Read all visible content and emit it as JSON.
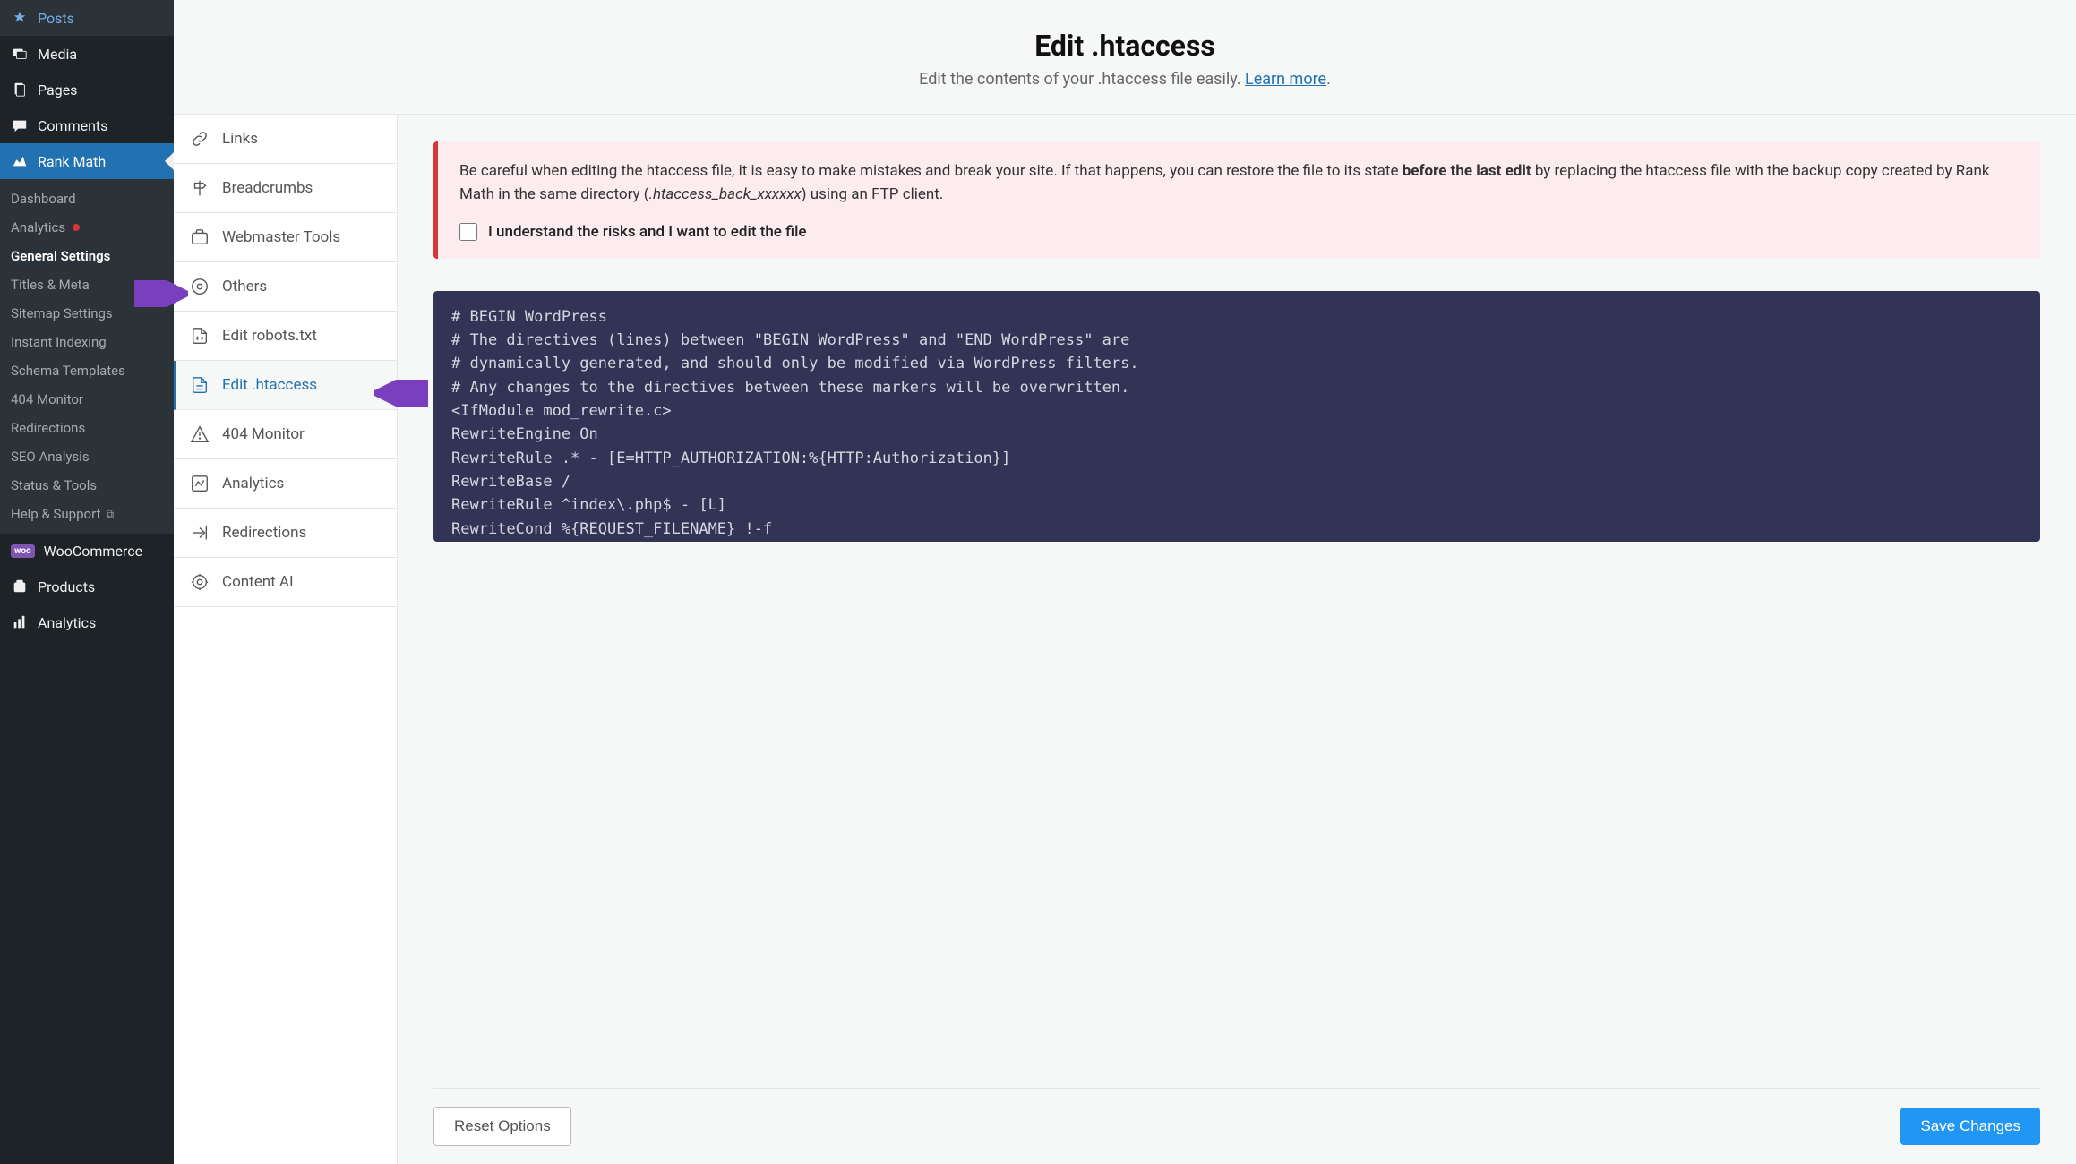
{
  "wp_menu": [
    {
      "id": "posts",
      "label": "Posts",
      "icon": "pin"
    },
    {
      "id": "media",
      "label": "Media",
      "icon": "media"
    },
    {
      "id": "pages",
      "label": "Pages",
      "icon": "pages"
    },
    {
      "id": "comments",
      "label": "Comments",
      "icon": "comments"
    },
    {
      "id": "rankmath",
      "label": "Rank Math",
      "icon": "rankmath",
      "active": true
    }
  ],
  "rankmath_submenu": [
    {
      "id": "dashboard",
      "label": "Dashboard"
    },
    {
      "id": "analytics",
      "label": "Analytics",
      "dot": true
    },
    {
      "id": "general-settings",
      "label": "General Settings",
      "active": true
    },
    {
      "id": "titles-meta",
      "label": "Titles & Meta"
    },
    {
      "id": "sitemap-settings",
      "label": "Sitemap Settings"
    },
    {
      "id": "instant-indexing",
      "label": "Instant Indexing"
    },
    {
      "id": "schema-templates",
      "label": "Schema Templates"
    },
    {
      "id": "404-monitor",
      "label": "404 Monitor"
    },
    {
      "id": "redirections",
      "label": "Redirections"
    },
    {
      "id": "seo-analysis",
      "label": "SEO Analysis"
    },
    {
      "id": "status-tools",
      "label": "Status & Tools"
    },
    {
      "id": "help-support",
      "label": "Help & Support",
      "ext": true
    }
  ],
  "wp_menu_after": [
    {
      "id": "woocommerce",
      "label": "WooCommerce",
      "icon": "woo"
    },
    {
      "id": "products",
      "label": "Products",
      "icon": "products"
    },
    {
      "id": "analytics-woo",
      "label": "Analytics",
      "icon": "bars"
    }
  ],
  "settings_tabs": [
    {
      "id": "links",
      "label": "Links"
    },
    {
      "id": "breadcrumbs",
      "label": "Breadcrumbs"
    },
    {
      "id": "webmaster-tools",
      "label": "Webmaster Tools"
    },
    {
      "id": "others",
      "label": "Others"
    },
    {
      "id": "edit-robots",
      "label": "Edit robots.txt"
    },
    {
      "id": "edit-htaccess",
      "label": "Edit .htaccess",
      "active": true
    },
    {
      "id": "404-monitor",
      "label": "404 Monitor"
    },
    {
      "id": "analytics",
      "label": "Analytics"
    },
    {
      "id": "redirections",
      "label": "Redirections"
    },
    {
      "id": "content-ai",
      "label": "Content AI"
    }
  ],
  "header": {
    "title": "Edit .htaccess",
    "subtitle_prefix": "Edit the contents of your .htaccess file easily. ",
    "learn_more": "Learn more",
    "subtitle_suffix": "."
  },
  "warning": {
    "text_before_bold": "Be careful when editing the htaccess file, it is easy to make mistakes and break your site. If that happens, you can restore the file to its state ",
    "bold": "before the last edit",
    "text_after_bold": " by replacing the htaccess file with the backup copy created by Rank Math in the same directory (",
    "italic": ".htaccess_back_xxxxxx",
    "text_after_italic": ") using an FTP client.",
    "consent": "I understand the risks and I want to edit the file"
  },
  "code": "# BEGIN WordPress\n# The directives (lines) between \"BEGIN WordPress\" and \"END WordPress\" are\n# dynamically generated, and should only be modified via WordPress filters.\n# Any changes to the directives between these markers will be overwritten.\n<IfModule mod_rewrite.c>\nRewriteEngine On\nRewriteRule .* - [E=HTTP_AUTHORIZATION:%{HTTP:Authorization}]\nRewriteBase /\nRewriteRule ^index\\.php$ - [L]\nRewriteCond %{REQUEST_FILENAME} !-f\nRewriteCond %{REQUEST_FILENAME} !-d",
  "footer": {
    "reset": "Reset Options",
    "save": "Save Changes"
  }
}
